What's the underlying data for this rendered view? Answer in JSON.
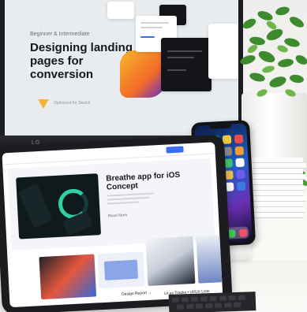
{
  "monitor": {
    "brand": "LG",
    "kicker": "Beginner & Intermediate",
    "headline": "Designing landing pages for conversion",
    "sketch_caption": "Optimized for Sketch"
  },
  "tablet": {
    "app_title": "Breathe app for iOS Concept",
    "read_more": "Read More",
    "caption_left": "Design Report →",
    "caption_right": "UI-ux Tracks • UI/UX Lists"
  },
  "colors": {
    "accent_blue": "#3a6df0",
    "ring_green": "#2fd0a3",
    "brand_orange": "#f26b2a"
  }
}
